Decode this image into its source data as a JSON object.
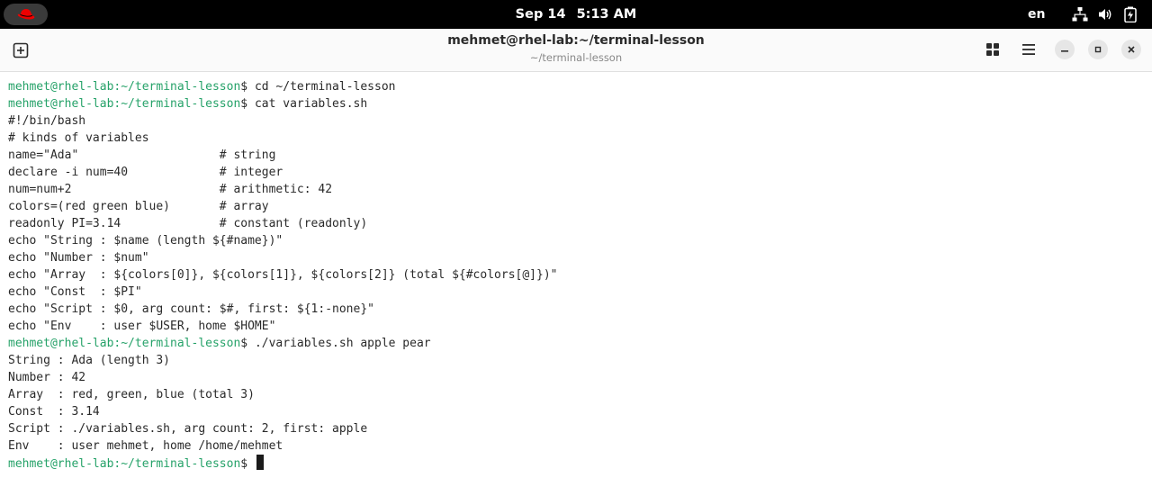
{
  "top_bar": {
    "date": "Sep 14",
    "time": "5:13 AM",
    "input_language": "en",
    "tray_icons": [
      "network-icon",
      "volume-icon",
      "battery-icon"
    ]
  },
  "window": {
    "title": "mehmet@rhel-lab:~/terminal-lesson",
    "subtitle": "~/terminal-lesson"
  },
  "prompt": {
    "user_host": "mehmet@rhel-lab",
    "path": ":~/terminal-lesson",
    "symbol": "$"
  },
  "terminal": {
    "lines": [
      {
        "kind": "prompt",
        "cmd": " cd ~/terminal-lesson"
      },
      {
        "kind": "prompt",
        "cmd": " cat variables.sh"
      },
      {
        "kind": "output",
        "text": "#!/bin/bash"
      },
      {
        "kind": "output",
        "text": "# kinds of variables"
      },
      {
        "kind": "output",
        "text": "name=\"Ada\"                    # string"
      },
      {
        "kind": "output",
        "text": "declare -i num=40             # integer"
      },
      {
        "kind": "output",
        "text": "num=num+2                     # arithmetic: 42"
      },
      {
        "kind": "output",
        "text": "colors=(red green blue)       # array"
      },
      {
        "kind": "output",
        "text": "readonly PI=3.14              # constant (readonly)"
      },
      {
        "kind": "output",
        "text": "echo \"String : $name (length ${#name})\""
      },
      {
        "kind": "output",
        "text": "echo \"Number : $num\""
      },
      {
        "kind": "output",
        "text": "echo \"Array  : ${colors[0]}, ${colors[1]}, ${colors[2]} (total ${#colors[@]})\""
      },
      {
        "kind": "output",
        "text": "echo \"Const  : $PI\""
      },
      {
        "kind": "output",
        "text": "echo \"Script : $0, arg count: $#, first: ${1:-none}\""
      },
      {
        "kind": "output",
        "text": "echo \"Env    : user $USER, home $HOME\""
      },
      {
        "kind": "prompt",
        "cmd": " ./variables.sh apple pear"
      },
      {
        "kind": "output",
        "text": "String : Ada (length 3)"
      },
      {
        "kind": "output",
        "text": "Number : 42"
      },
      {
        "kind": "output",
        "text": "Array  : red, green, blue (total 3)"
      },
      {
        "kind": "output",
        "text": "Const  : 3.14"
      },
      {
        "kind": "output",
        "text": "Script : ./variables.sh, arg count: 2, first: apple"
      },
      {
        "kind": "output",
        "text": "Env    : user mehmet, home /home/mehmet"
      },
      {
        "kind": "prompt",
        "cmd": " ",
        "cursor": true
      }
    ]
  },
  "colors": {
    "prompt": "#26a269",
    "text": "#2a2a2a",
    "topbar": "#000000"
  }
}
